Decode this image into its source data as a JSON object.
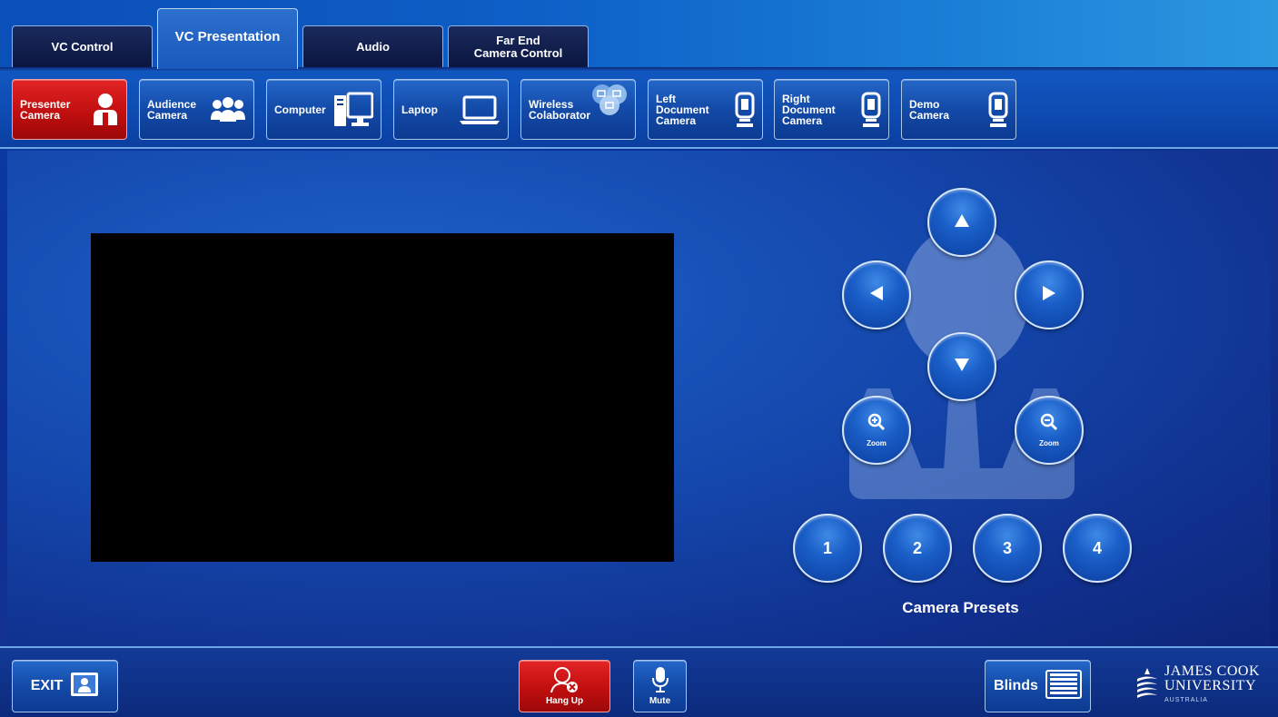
{
  "tabs": [
    {
      "label": "VC Control",
      "active": false
    },
    {
      "label": "VC Presentation",
      "active": true
    },
    {
      "label": "Audio",
      "active": false
    },
    {
      "label": "Far End\nCamera Control",
      "active": false
    }
  ],
  "sources": [
    {
      "label": "Presenter\nCamera",
      "icon": "presenter-icon",
      "active": true
    },
    {
      "label": "Audience\nCamera",
      "icon": "audience-icon",
      "active": false
    },
    {
      "label": "Computer",
      "icon": "computer-icon",
      "active": false
    },
    {
      "label": "Laptop",
      "icon": "laptop-icon",
      "active": false
    },
    {
      "label": "Wireless\nColaborator",
      "icon": "wireless-icon",
      "active": false
    },
    {
      "label": "Left\nDocument\nCamera",
      "icon": "document-camera-icon",
      "active": false
    },
    {
      "label": "Right\nDocument\nCamera",
      "icon": "document-camera-icon",
      "active": false
    },
    {
      "label": "Demo\nCamera",
      "icon": "document-camera-icon",
      "active": false
    }
  ],
  "ptz": {
    "zoom_in_label": "Zoom",
    "zoom_out_label": "Zoom"
  },
  "presets": {
    "buttons": [
      "1",
      "2",
      "3",
      "4"
    ],
    "label": "Camera Presets"
  },
  "bottom": {
    "exit_label": "EXIT",
    "hangup_label": "Hang Up",
    "mute_label": "Mute",
    "blinds_label": "Blinds"
  },
  "logo": {
    "line1": "JAMES COOK",
    "line2": "UNIVERSITY",
    "line3": "AUSTRALIA"
  },
  "colors": {
    "accent_blue": "#1a5ec8",
    "active_red": "#c10f0f"
  }
}
